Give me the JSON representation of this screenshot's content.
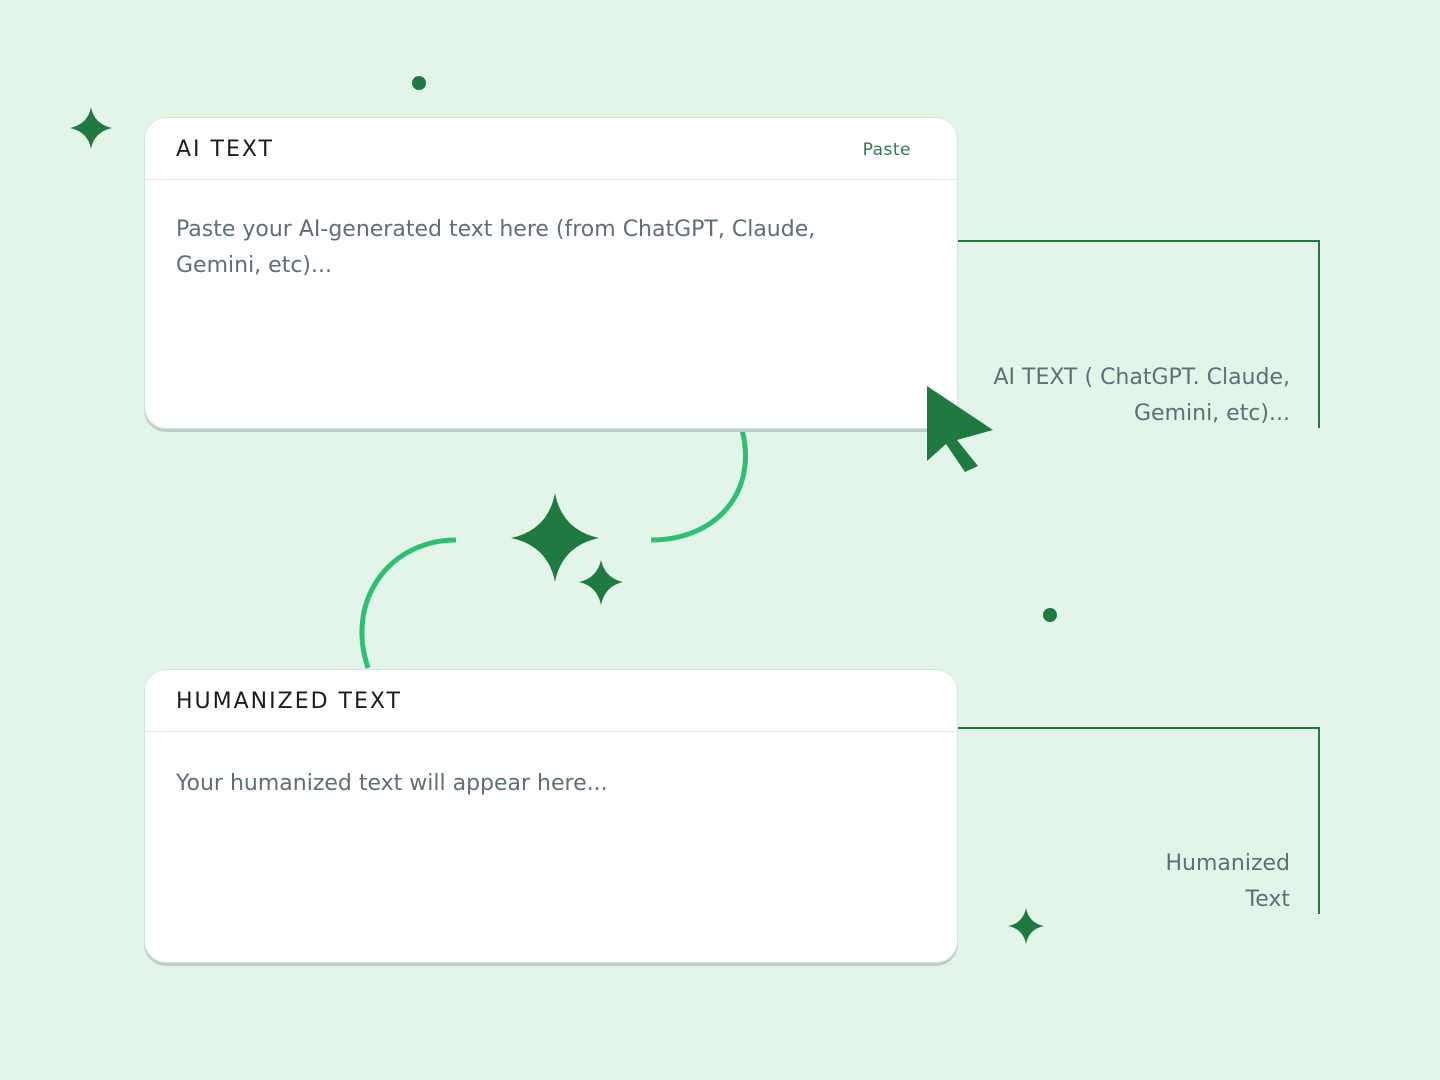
{
  "ai_card": {
    "title": "AI TEXT",
    "paste_label": "Paste",
    "input_value": "",
    "input_placeholder": "Paste your AI-generated text here (from ChatGPT, Claude, Gemini, etc)..."
  },
  "humanized_card": {
    "title": "HUMANIZED TEXT",
    "placeholder": "Your humanized text will appear here..."
  },
  "callouts": {
    "ai": "AI TEXT ( ChatGPT. Claude, Gemini, etc)...",
    "humanized_line1": "Humanized",
    "humanized_line2": "Text"
  },
  "colors": {
    "background": "#e3f5e9",
    "accent_dark": "#1e7a3e",
    "accent_light": "#2fbf71",
    "text_muted": "#5e6f76"
  }
}
